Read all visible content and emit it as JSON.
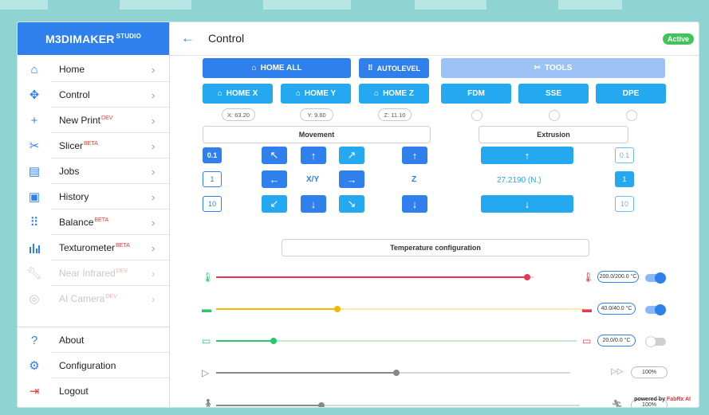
{
  "brand": {
    "name": "M3DIMAKER",
    "sup": "STUDIO"
  },
  "sidebar": {
    "items": [
      {
        "label": "Home",
        "sup": "",
        "icon": "home-icon"
      },
      {
        "label": "Control",
        "sup": "",
        "icon": "move-icon"
      },
      {
        "label": "New Print",
        "sup": "DEV",
        "icon": "plus-icon"
      },
      {
        "label": "Slicer",
        "sup": "BETA",
        "icon": "tools-icon"
      },
      {
        "label": "Jobs",
        "sup": "",
        "icon": "document-icon"
      },
      {
        "label": "History",
        "sup": "",
        "icon": "history-icon"
      },
      {
        "label": "Balance",
        "sup": "BETA",
        "icon": "grid-icon"
      },
      {
        "label": "Texturometer",
        "sup": "BETA",
        "icon": "bar-chart-icon"
      },
      {
        "label": "Near Infrared",
        "sup": "DEV",
        "icon": "wrench-icon"
      },
      {
        "label": "AI Camera",
        "sup": "DEV",
        "icon": "camera-icon"
      }
    ],
    "bottom": [
      {
        "label": "About",
        "icon": "question-icon"
      },
      {
        "label": "Configuration",
        "icon": "gear-icon"
      },
      {
        "label": "Logout",
        "icon": "logout-icon"
      }
    ]
  },
  "header": {
    "title": "Control",
    "status": "Active"
  },
  "buttons": {
    "home_all": "HOME ALL",
    "autolevel": "AUTOLEVEL",
    "tools": "TOOLS",
    "home_x": "HOME X",
    "home_y": "HOME Y",
    "home_z": "HOME Z",
    "fdm": "FDM",
    "sse": "SSE",
    "dpe": "DPE"
  },
  "coords": {
    "x": "X: 63.20",
    "y": "Y: 9.60",
    "z": "Z: 11.10"
  },
  "sections": {
    "movement": "Movement",
    "extrusion": "Extrusion",
    "temperature": "Temperature configuration"
  },
  "steps": {
    "left": [
      "0.1",
      "1",
      "10"
    ],
    "right": [
      "0.1",
      "1",
      "10"
    ],
    "active_left": "0.1",
    "active_right": "1"
  },
  "jog": {
    "xy_label": "X/Y",
    "z_label": "Z",
    "extrusion_value": "27.2190 (N.)"
  },
  "sliders": [
    {
      "name": "nozzle",
      "value": "200.0/200.0 °C",
      "fraction": 0.98,
      "enabled": true,
      "color": "#e53950"
    },
    {
      "name": "bed",
      "value": "40.0/40.0 °C",
      "fraction": 0.33,
      "enabled": true,
      "color": "#f5b800"
    },
    {
      "name": "chamber",
      "value": "20.0/0.0 °C",
      "fraction": 0.16,
      "enabled": false,
      "color": "#2cc76b"
    },
    {
      "name": "speed",
      "value": "100%",
      "fraction": 0.51
    },
    {
      "name": "flow",
      "value": "100%",
      "fraction": 0.29
    }
  ],
  "powered": {
    "prefix": "powered by",
    "brand": "FabRx AI"
  },
  "colors": {
    "primary": "#2f80ed",
    "light": "#24a9f0",
    "pale": "#9cc2f6",
    "active": "#43c45a"
  }
}
